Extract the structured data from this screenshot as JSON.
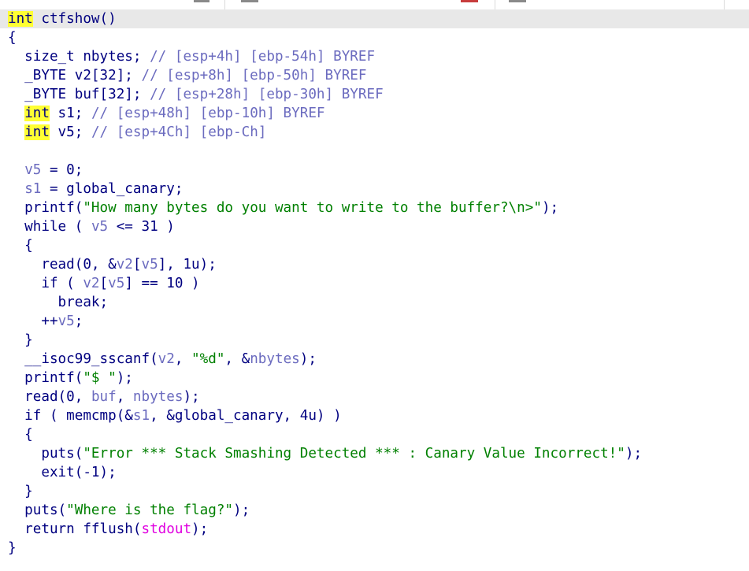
{
  "colors": {
    "background": "#ffffff",
    "current_line": "#e8e8e8",
    "code_default": "#000080",
    "local_variable": "#6b6bbf",
    "comment": "#6b6bbf",
    "string_literal": "#008000",
    "extern_symbol": "#e000e0",
    "highlight": "#ffff33"
  },
  "pseudocode": {
    "current_line_index": 0,
    "lines": [
      [
        {
          "t": "int",
          "c": "kw",
          "hl": true
        },
        {
          "t": " ctfshow()",
          "c": "ident"
        }
      ],
      [
        {
          "t": "{",
          "c": "punct"
        }
      ],
      [
        {
          "t": "  size_t nbytes; ",
          "c": "ident"
        },
        {
          "t": "// [esp+4h] [ebp-54h] BYREF",
          "c": "comment"
        }
      ],
      [
        {
          "t": "  _BYTE v2[32]; ",
          "c": "ident"
        },
        {
          "t": "// [esp+8h] [ebp-50h] BYREF",
          "c": "comment"
        }
      ],
      [
        {
          "t": "  _BYTE buf[32]; ",
          "c": "ident"
        },
        {
          "t": "// [esp+28h] [ebp-30h] BYREF",
          "c": "comment"
        }
      ],
      [
        {
          "t": "  ",
          "c": "pad"
        },
        {
          "t": "int",
          "c": "kw",
          "hl": true
        },
        {
          "t": " s1; ",
          "c": "ident"
        },
        {
          "t": "// [esp+48h] [ebp-10h] BYREF",
          "c": "comment"
        }
      ],
      [
        {
          "t": "  ",
          "c": "pad"
        },
        {
          "t": "int",
          "c": "kw",
          "hl": true
        },
        {
          "t": " v5; ",
          "c": "ident"
        },
        {
          "t": "// [esp+4Ch] [ebp-Ch]",
          "c": "comment"
        }
      ],
      [],
      [
        {
          "t": "  ",
          "c": "pad"
        },
        {
          "t": "v5",
          "c": "var"
        },
        {
          "t": " = 0;",
          "c": "ident"
        }
      ],
      [
        {
          "t": "  ",
          "c": "pad"
        },
        {
          "t": "s1",
          "c": "var"
        },
        {
          "t": " = global_canary;",
          "c": "ident"
        }
      ],
      [
        {
          "t": "  printf(",
          "c": "ident"
        },
        {
          "t": "\"How many bytes do you want to write to the buffer?\\n>\"",
          "c": "str"
        },
        {
          "t": ");",
          "c": "ident"
        }
      ],
      [
        {
          "t": "  while ( ",
          "c": "ident"
        },
        {
          "t": "v5",
          "c": "var"
        },
        {
          "t": " <= 31 )",
          "c": "ident"
        }
      ],
      [
        {
          "t": "  {",
          "c": "punct"
        }
      ],
      [
        {
          "t": "    read(0, &",
          "c": "ident"
        },
        {
          "t": "v2",
          "c": "var"
        },
        {
          "t": "[",
          "c": "ident"
        },
        {
          "t": "v5",
          "c": "var"
        },
        {
          "t": "], 1u);",
          "c": "ident"
        }
      ],
      [
        {
          "t": "    if ( ",
          "c": "ident"
        },
        {
          "t": "v2",
          "c": "var"
        },
        {
          "t": "[",
          "c": "ident"
        },
        {
          "t": "v5",
          "c": "var"
        },
        {
          "t": "] == 10 )",
          "c": "ident"
        }
      ],
      [
        {
          "t": "      break;",
          "c": "ident"
        }
      ],
      [
        {
          "t": "    ++",
          "c": "ident"
        },
        {
          "t": "v5",
          "c": "var"
        },
        {
          "t": ";",
          "c": "ident"
        }
      ],
      [
        {
          "t": "  }",
          "c": "punct"
        }
      ],
      [
        {
          "t": "  __isoc99_sscanf(",
          "c": "ident"
        },
        {
          "t": "v2",
          "c": "var"
        },
        {
          "t": ", ",
          "c": "ident"
        },
        {
          "t": "\"%d\"",
          "c": "str"
        },
        {
          "t": ", &",
          "c": "ident"
        },
        {
          "t": "nbytes",
          "c": "var"
        },
        {
          "t": ");",
          "c": "ident"
        }
      ],
      [
        {
          "t": "  printf(",
          "c": "ident"
        },
        {
          "t": "\"$ \"",
          "c": "str"
        },
        {
          "t": ");",
          "c": "ident"
        }
      ],
      [
        {
          "t": "  read(0, ",
          "c": "ident"
        },
        {
          "t": "buf",
          "c": "var"
        },
        {
          "t": ", ",
          "c": "ident"
        },
        {
          "t": "nbytes",
          "c": "var"
        },
        {
          "t": ");",
          "c": "ident"
        }
      ],
      [
        {
          "t": "  if ( memcmp(&",
          "c": "ident"
        },
        {
          "t": "s1",
          "c": "var"
        },
        {
          "t": ", &global_canary, 4u) )",
          "c": "ident"
        }
      ],
      [
        {
          "t": "  {",
          "c": "punct"
        }
      ],
      [
        {
          "t": "    puts(",
          "c": "ident"
        },
        {
          "t": "\"Error *** Stack Smashing Detected *** : Canary Value Incorrect!\"",
          "c": "str"
        },
        {
          "t": ");",
          "c": "ident"
        }
      ],
      [
        {
          "t": "    exit(-1);",
          "c": "ident"
        }
      ],
      [
        {
          "t": "  }",
          "c": "punct"
        }
      ],
      [
        {
          "t": "  puts(",
          "c": "ident"
        },
        {
          "t": "\"Where is the flag?\"",
          "c": "str"
        },
        {
          "t": ");",
          "c": "ident"
        }
      ],
      [
        {
          "t": "  return fflush(",
          "c": "ident"
        },
        {
          "t": "stdout",
          "c": "extern"
        },
        {
          "t": ");",
          "c": "ident"
        }
      ],
      [
        {
          "t": "}",
          "c": "punct"
        }
      ]
    ]
  }
}
